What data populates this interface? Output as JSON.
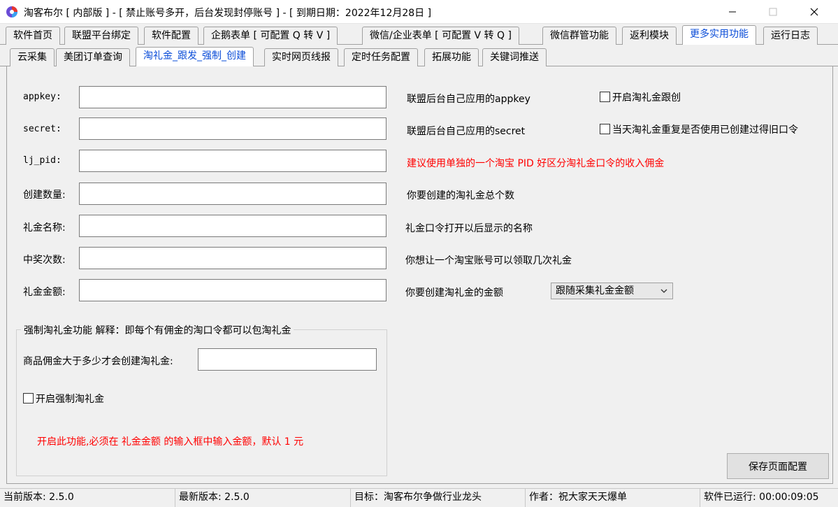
{
  "window": {
    "title": "淘客布尔 [ 内部版 ]  - [ 禁止账号多开，后台发现封停账号 ]  - [ 到期日期：2022年12月28日 ]"
  },
  "tabs_main": [
    {
      "label": "软件首页"
    },
    {
      "label": "联盟平台绑定"
    },
    {
      "label": "软件配置"
    },
    {
      "label": "企鹅表单 [ 可配置 Q 转 V ]"
    },
    {
      "label": "微信/企业表单 [ 可配置 V 转 Q ]"
    },
    {
      "label": "微信群管功能"
    },
    {
      "label": "返利模块"
    },
    {
      "label": "更多实用功能"
    },
    {
      "label": "运行日志"
    }
  ],
  "tabs_sub": [
    {
      "label": "云采集"
    },
    {
      "label": "美团订单查询"
    },
    {
      "label": "淘礼金_跟发_强制_创建"
    },
    {
      "label": "实时网页线报"
    },
    {
      "label": "定时任务配置"
    },
    {
      "label": "拓展功能"
    },
    {
      "label": "关键词推送"
    }
  ],
  "form": {
    "appkey": {
      "label": "appkey:",
      "value": "",
      "hint": "联盟后台自己应用的appkey"
    },
    "secret": {
      "label": "secret:",
      "value": "",
      "hint": "联盟后台自己应用的secret"
    },
    "lj_pid": {
      "label": "lj_pid:",
      "value": "",
      "hint": "建议使用单独的一个淘宝 PID  好区分淘礼金口令的收入佣金"
    },
    "count": {
      "label": "创建数量:",
      "value": "",
      "hint": "你要创建的淘礼金总个数"
    },
    "name": {
      "label": "礼金名称:",
      "value": "",
      "hint": "礼金口令打开以后显示的名称"
    },
    "times": {
      "label": "中奖次数:",
      "value": "",
      "hint": "你想让一个淘宝账号可以领取几次礼金"
    },
    "amount": {
      "label": "礼金金额:",
      "value": "",
      "hint": "你要创建淘礼金的金额",
      "select_value": "跟随采集礼金金额"
    }
  },
  "checkboxes": {
    "enable_follow": {
      "label": "开启淘礼金跟创",
      "checked": false
    },
    "reuse_today": {
      "label": "当天淘礼金重复是否使用已创建过得旧口令",
      "checked": false
    },
    "enable_force": {
      "label": "开启强制淘礼金",
      "checked": false
    }
  },
  "force_group": {
    "title": "强制淘礼金功能  解释：即每个有佣金的淘口令都可以包淘礼金",
    "commission_label": "商品佣金大于多少才会创建淘礼金:",
    "commission_value": "",
    "note": "开启此功能,必须在 礼金金额 的输入框中输入金额，默认 1 元"
  },
  "save_button": {
    "label": "保存页面配置"
  },
  "status": {
    "current_version": "当前版本: 2.5.0",
    "latest_version": "最新版本: 2.5.0",
    "target": "目标：淘客布尔争做行业龙头",
    "author": "作者：祝大家天天爆单",
    "runtime": "软件已运行: 00:00:09:05"
  },
  "colors": {
    "active_tab_text": "#0b4dd8",
    "warning_text": "#ff0000"
  }
}
